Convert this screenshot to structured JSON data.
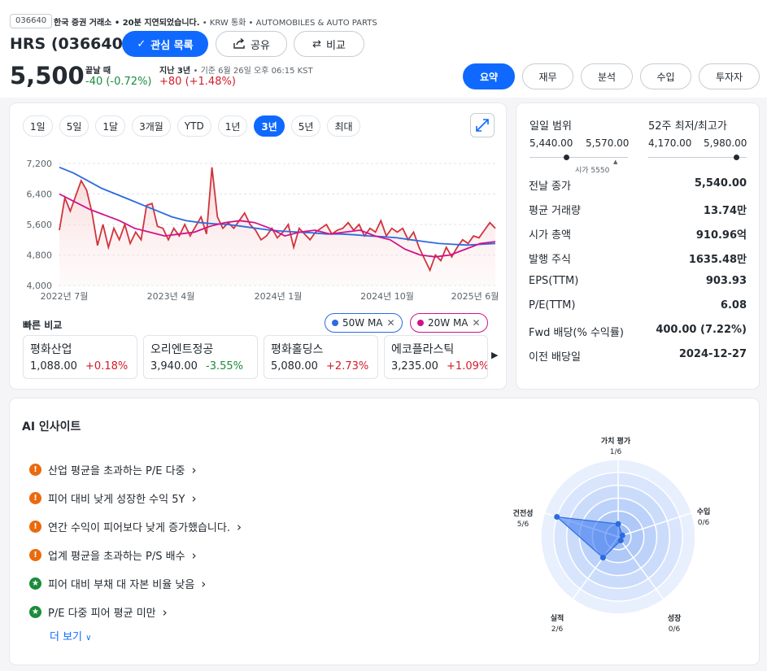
{
  "header": {
    "ticker_chip": "036640",
    "exchange_info": "한국 증권 거래소 • 20분 지연되었습니다.",
    "currency": "• KRW 통화",
    "sector": "• AUTOMOBILES & AUTO PARTS",
    "title": "HRS (036640)",
    "watchlist_label": "관심 목록",
    "share_label": "공유",
    "compare_label": "비교",
    "price": "5,500",
    "close_label": "끝날 때",
    "close_change": "-40 (-0.72%)",
    "period_label": "지난 3년",
    "as_of": "• 기준 6월 26일 오후 06:15 KST",
    "period_change": "+80 (+1.48%)"
  },
  "tabs": [
    {
      "label": "요약",
      "active": true
    },
    {
      "label": "재무"
    },
    {
      "label": "분석"
    },
    {
      "label": "수입"
    },
    {
      "label": "투자자"
    }
  ],
  "ranges": [
    "1일",
    "5일",
    "1달",
    "3개월",
    "YTD",
    "1년",
    "3년",
    "5년",
    "최대"
  ],
  "active_range": "3년",
  "chart_data": {
    "type": "line",
    "y_ticks": [
      "7,200",
      "6,400",
      "5,600",
      "4,800",
      "4,000"
    ],
    "ylim": [
      4000,
      7200
    ],
    "x_ticks": [
      "2022년 7월",
      "2023년 4월",
      "2024년 1월",
      "2024년 10월",
      "2025년 6월"
    ],
    "series": [
      {
        "name": "price",
        "color": "#d0343b",
        "values": [
          5450,
          6300,
          5950,
          6350,
          6750,
          6500,
          5900,
          5050,
          5600,
          5000,
          5500,
          5200,
          5600,
          5100,
          5400,
          5200,
          6100,
          6150,
          5550,
          5500,
          5200,
          5500,
          5300,
          5600,
          5300,
          5550,
          5800,
          5350,
          7100,
          5800,
          5500,
          5650,
          5500,
          5700,
          5900,
          5600,
          5450,
          5200,
          5300,
          5500,
          5250,
          5400,
          5600,
          5000,
          5500,
          5350,
          5200,
          5400,
          5500,
          5600,
          5350,
          5450,
          5500,
          5650,
          5450,
          5600,
          5300,
          5500,
          5400,
          5700,
          5300,
          5500,
          5400,
          5500,
          5200,
          5400,
          5000,
          4700,
          4400,
          4800,
          4650,
          5000,
          4750,
          5000,
          5200,
          5100,
          5300,
          5250,
          5450,
          5650,
          5500
        ]
      },
      {
        "name": "50W MA",
        "color": "#2c6be0",
        "values": [
          7100,
          6950,
          6750,
          6550,
          6400,
          6250,
          6100,
          5950,
          5800,
          5700,
          5650,
          5620,
          5600,
          5550,
          5500,
          5450,
          5420,
          5400,
          5380,
          5350,
          5350,
          5330,
          5300,
          5280,
          5250,
          5200,
          5150,
          5100,
          5080,
          5060,
          5080,
          5100
        ]
      },
      {
        "name": "20W MA",
        "color": "#d0138b",
        "values": [
          6400,
          6200,
          6000,
          5850,
          5700,
          5500,
          5400,
          5300,
          5350,
          5400,
          5550,
          5650,
          5700,
          5650,
          5500,
          5300,
          5400,
          5450,
          5350,
          5400,
          5450,
          5300,
          5200,
          4950,
          4800,
          4750,
          4800,
          4950,
          5100,
          5150
        ]
      }
    ]
  },
  "quick_compare": {
    "title": "빠른 비교",
    "ma50_label": "50W MA",
    "ma20_label": "20W MA",
    "peers": [
      {
        "name": "평화산업",
        "price": "1,088.00",
        "change": "+0.18%",
        "dir": "pos"
      },
      {
        "name": "오리엔트정공",
        "price": "3,940.00",
        "change": "-3.55%",
        "dir": "neg"
      },
      {
        "name": "평화홀딩스",
        "price": "5,080.00",
        "change": "+2.73%",
        "dir": "pos"
      },
      {
        "name": "에코플라스틱",
        "price": "3,235.00",
        "change": "+1.09%",
        "dir": "pos"
      }
    ]
  },
  "stats": {
    "day_range_label": "일일 범위",
    "day_low": "5,440.00",
    "day_high": "5,570.00",
    "open_note": "시가 5550",
    "wk52_label": "52주 최저/최고가",
    "wk52_low": "4,170.00",
    "wk52_high": "5,980.00",
    "day_dot_fraction": 0.38,
    "wk52_dot_fraction": 0.9,
    "rows": [
      {
        "label": "전날 종가",
        "value": "5,540.00"
      },
      {
        "label": "평균 거래량",
        "value": "13.74만"
      },
      {
        "label": "시가 총액",
        "value": "910.96억"
      },
      {
        "label": "발행 주식",
        "value": "1635.48만"
      },
      {
        "label": "EPS(TTM)",
        "value": "903.93"
      },
      {
        "label": "P/E(TTM)",
        "value": "6.08"
      },
      {
        "label": "Fwd 배당(% 수익률)",
        "value": "400.00 (7.22%)"
      },
      {
        "label": "이전 배당일",
        "value": "2024-12-27"
      }
    ]
  },
  "ai": {
    "title": "AI 인사이트",
    "insights": [
      {
        "text": "산업 평균을 초과하는 P/E 다중",
        "type": "warn"
      },
      {
        "text": "피어 대비 낮게 성장한 수익 5Y",
        "type": "warn"
      },
      {
        "text": "연간 수익이 피어보다 낮게 증가했습니다.",
        "type": "warn"
      },
      {
        "text": "업계 평균을 초과하는 P/S 배수",
        "type": "warn"
      },
      {
        "text": "피어 대비 부채 대 자본 비율 낮음",
        "type": "good"
      },
      {
        "text": "P/E 다중 피어 평균 미만",
        "type": "good"
      }
    ],
    "more_label": "더 보기",
    "radar": [
      {
        "label": "가치 평가",
        "score": "1/6",
        "value": 1
      },
      {
        "label": "수입",
        "score": "0/6",
        "value": 0
      },
      {
        "label": "성장",
        "score": "0/6",
        "value": 0
      },
      {
        "label": "실적",
        "score": "2/6",
        "value": 2
      },
      {
        "label": "건전성",
        "score": "5/6",
        "value": 5
      }
    ]
  },
  "colors": {
    "accent": "#0f69ff",
    "positive": "#d11d2a",
    "negative": "#1a8c3b"
  }
}
